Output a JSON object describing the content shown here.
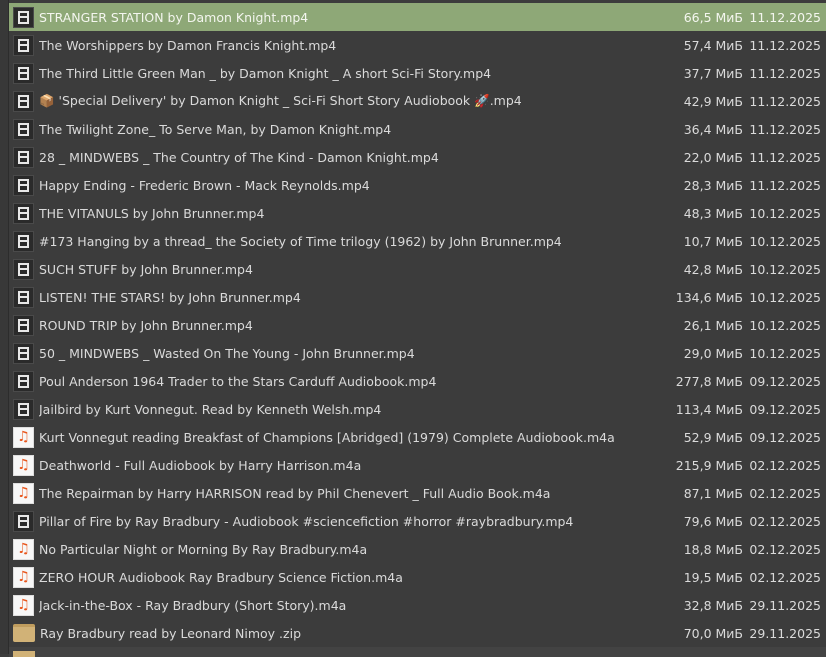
{
  "files": [
    {
      "name": "STRANGER STATION by Damon Knight.mp4",
      "size": "66,5 МиБ",
      "date": "11.12.2025",
      "type": "video",
      "selected": true
    },
    {
      "name": "The Worshippers by Damon Francis Knight.mp4",
      "size": "57,4 МиБ",
      "date": "11.12.2025",
      "type": "video"
    },
    {
      "name": "The Third Little Green Man _ by Damon Knight _ A short Sci-Fi Story.mp4",
      "size": "37,7 МиБ",
      "date": "11.12.2025",
      "type": "video"
    },
    {
      "name": "📦 'Special Delivery' by Damon Knight _ Sci-Fi Short Story Audiobook 🚀.mp4",
      "size": "42,9 МиБ",
      "date": "11.12.2025",
      "type": "video"
    },
    {
      "name": "The Twilight Zone_ To Serve Man, by Damon Knight.mp4",
      "size": "36,4 МиБ",
      "date": "11.12.2025",
      "type": "video"
    },
    {
      "name": "28 _ MINDWEBS _ The Country of The Kind - Damon Knight.mp4",
      "size": "22,0 МиБ",
      "date": "11.12.2025",
      "type": "video"
    },
    {
      "name": "Happy Ending - Frederic Brown - Mack Reynolds.mp4",
      "size": "28,3 МиБ",
      "date": "11.12.2025",
      "type": "video"
    },
    {
      "name": "THE VITANULS by John Brunner.mp4",
      "size": "48,3 МиБ",
      "date": "10.12.2025",
      "type": "video"
    },
    {
      "name": "#173 Hanging by a thread_ the Society of Time trilogy (1962) by John Brunner.mp4",
      "size": "10,7 МиБ",
      "date": "10.12.2025",
      "type": "video"
    },
    {
      "name": "SUCH STUFF by John Brunner.mp4",
      "size": "42,8 МиБ",
      "date": "10.12.2025",
      "type": "video"
    },
    {
      "name": "LISTEN! THE STARS! by John Brunner.mp4",
      "size": "134,6 МиБ",
      "date": "10.12.2025",
      "type": "video"
    },
    {
      "name": "ROUND TRIP by John Brunner.mp4",
      "size": "26,1 МиБ",
      "date": "10.12.2025",
      "type": "video"
    },
    {
      "name": "50 _ MINDWEBS _ Wasted On The Young - John Brunner.mp4",
      "size": "29,0 МиБ",
      "date": "10.12.2025",
      "type": "video"
    },
    {
      "name": "Poul Anderson 1964 Trader to the Stars Carduff Audiobook.mp4",
      "size": "277,8 МиБ",
      "date": "09.12.2025",
      "type": "video"
    },
    {
      "name": "Jailbird by Kurt Vonnegut. Read by Kenneth Welsh.mp4",
      "size": "113,4 МиБ",
      "date": "09.12.2025",
      "type": "video"
    },
    {
      "name": "Kurt Vonnegut reading Breakfast of Champions [Abridged] (1979) Complete Audiobook.m4a",
      "size": "52,9 МиБ",
      "date": "09.12.2025",
      "type": "audio"
    },
    {
      "name": "Deathworld - Full Audiobook by Harry Harrison.m4a",
      "size": "215,9 МиБ",
      "date": "02.12.2025",
      "type": "audio"
    },
    {
      "name": "The Repairman by Harry HARRISON read by Phil Chenevert _ Full Audio Book.m4a",
      "size": "87,1 МиБ",
      "date": "02.12.2025",
      "type": "audio"
    },
    {
      "name": "Pillar of Fire by Ray Bradbury - Audiobook #sciencefiction #horror #raybradbury.mp4",
      "size": "79,6 МиБ",
      "date": "02.12.2025",
      "type": "video"
    },
    {
      "name": "No Particular Night or Morning By Ray Bradbury.m4a",
      "size": "18,8 МиБ",
      "date": "02.12.2025",
      "type": "audio"
    },
    {
      "name": "ZERO HOUR Audiobook Ray Bradbury Science Fiction.m4a",
      "size": "19,5 МиБ",
      "date": "02.12.2025",
      "type": "audio"
    },
    {
      "name": "Jack-in-the-Box - Ray Bradbury (Short Story).m4a",
      "size": "32,8 МиБ",
      "date": "29.11.2025",
      "type": "audio"
    },
    {
      "name": "Ray Bradbury read by Leonard Nimoy .zip",
      "size": "70,0 МиБ",
      "date": "29.11.2025",
      "type": "archive"
    }
  ],
  "colors": {
    "background": "#3c3c3c",
    "selection": "#8ea877",
    "audio_icon": "#e8571e",
    "archive_icon": "#d1b277"
  }
}
